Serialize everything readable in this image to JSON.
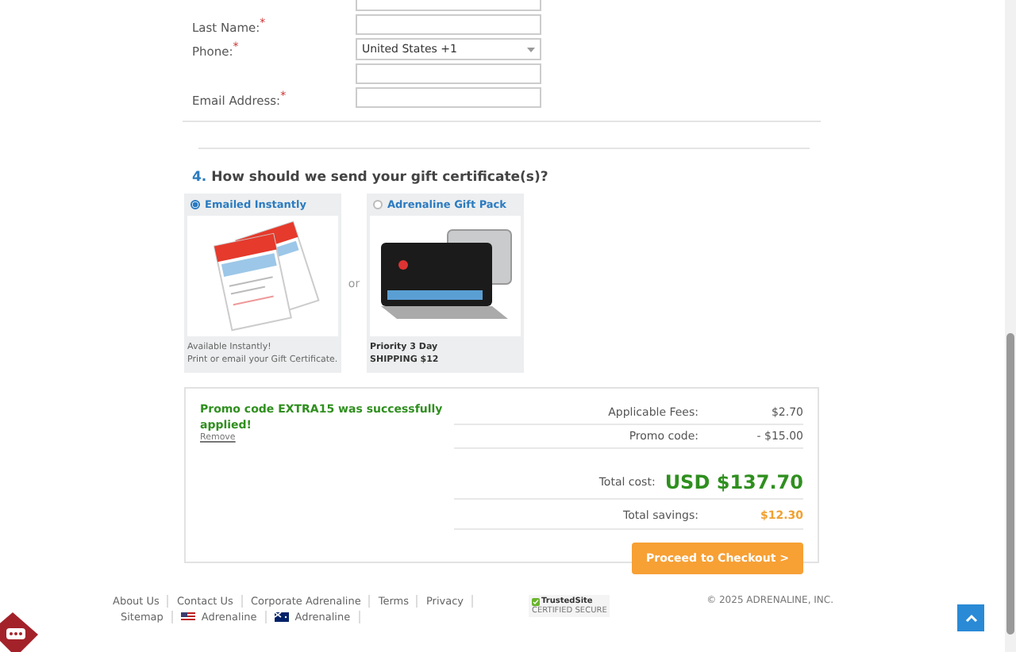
{
  "contact_fields": [
    {
      "label": "Last Name:$^{*}$",
      "kind": "text"
    },
    {
      "label": "Phone:$^{*}$",
      "kind": "phone",
      "value": "United States +1"
    },
    {
      "label": "Email Address:$^{*}$",
      "kind": "text"
    }
  ],
  "delivery": {
    "number": "4.",
    "heading": "How should we send your gift certificate(s)?",
    "separator": "or",
    "options": [
      {
        "label": "Emailed Instantly",
        "selected": true,
        "kind": "email",
        "lines": [
          "Available Instantly!",
          "Print or email your Gift Certificate."
        ]
      },
      {
        "label": "Adrenaline Gift Pack",
        "selected": false,
        "kind": "pack",
        "lines": [
          "Priority 3 Day",
          "SHIPPING $12"
        ]
      }
    ]
  },
  "summary": {
    "promo_message": "Promo code EXTRA15 was successfully applied!",
    "remove_link": "Remove",
    "fees": [
      {
        "label": "Applicable Fees:",
        "value": "$2.70"
      },
      {
        "label": "Promo code:",
        "value": "- $15.00"
      }
    ],
    "total_label": "Total cost:",
    "total_value": "USD $137.70",
    "savings_label": "Total savings:",
    "savings_value": "$12.30",
    "checkout_button": "Proceed to Checkout >"
  },
  "footer": {
    "links": [
      {
        "label": "About Us",
        "kind": "plain"
      },
      {
        "label": "Contact Us",
        "kind": "plain"
      },
      {
        "label": "Corporate Adrenaline",
        "kind": "plain"
      },
      {
        "label": "Terms",
        "kind": "plain"
      },
      {
        "label": "Privacy",
        "kind": "plain"
      },
      {
        "label": "Sitemap",
        "kind": "plain"
      },
      {
        "label": "Adrenaline",
        "kind": "usflag"
      },
      {
        "label": "Adrenaline",
        "kind": "auflag"
      }
    ],
    "badge_title": "TrustedSite",
    "badge_subtitle": "CERTIFIED SECURE",
    "copyright": "© 2025 ADRENALINE, INC."
  }
}
